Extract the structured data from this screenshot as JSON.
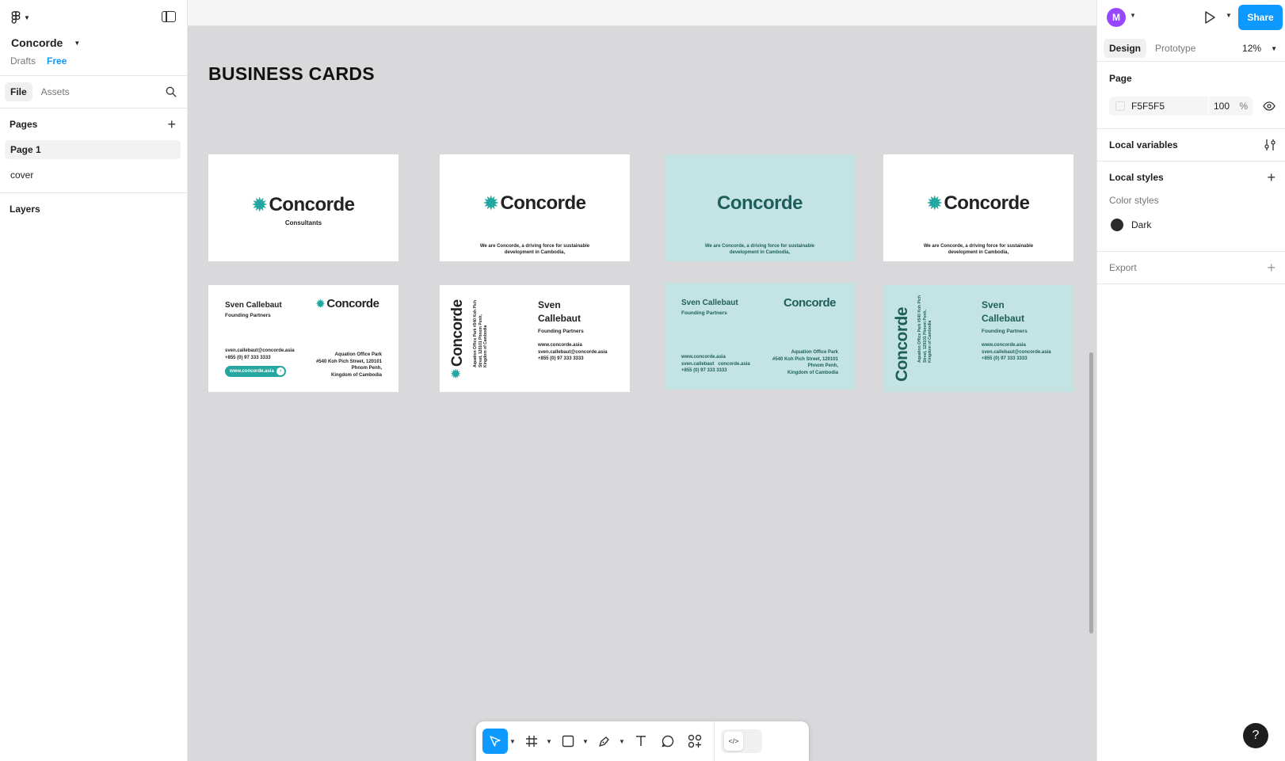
{
  "file": {
    "name": "Concorde",
    "location": "Drafts",
    "plan": "Free"
  },
  "left_tabs": [
    "File",
    "Assets"
  ],
  "pages": {
    "title": "Pages",
    "items": [
      "Page 1",
      "cover"
    ]
  },
  "layers": {
    "title": "Layers"
  },
  "canvas": {
    "title": "BUSINESS CARDS",
    "brand": "Concorde",
    "consultants": "Consultants",
    "tagline_1": "We are Concorde, a driving force for sustainable",
    "tagline_2": "development in Cambodia,",
    "person_name": "Sven Callebaut",
    "name_first": "Sven",
    "name_last": "Callebaut",
    "role": "Founding Partners",
    "email": "sven.callebaut@concorde.asia",
    "phone": "+855 (0) 97 333 3333",
    "website": "www.concorde.asia",
    "email_split_1": "sven.callebaut",
    "email_split_2": "concorde.asia",
    "addr_1": "Aquation Office Park",
    "addr_2": "#540 Koh Pich Street, 120101",
    "addr_3": "Phnom Penh,",
    "addr_4": "Kingdom of Cambodia",
    "vert_addr_1": "Aquation Office Park #540 Koh Pich",
    "vert_addr_2": "Street, 120101 Phnom Penh,",
    "vert_addr_3": "Kingdom of Cambodia"
  },
  "toolbar": {
    "tools": [
      "move-tool",
      "frame-tool",
      "shape-tool",
      "pen-tool",
      "text-tool",
      "comment-tool",
      "actions-tool"
    ],
    "dev_mode_icon": "</>"
  },
  "right_panel": {
    "avatar_initial": "M",
    "share_label": "Share",
    "tabs": [
      "Design",
      "Prototype"
    ],
    "zoom": "12%",
    "page_section": {
      "title": "Page",
      "fill_hex": "F5F5F5",
      "opacity": "100",
      "opacity_unit": "%"
    },
    "local_variables": "Local variables",
    "local_styles": "Local styles",
    "color_styles_label": "Color styles",
    "styles": [
      {
        "name": "Dark",
        "color": "#2c2c2c"
      }
    ],
    "export": "Export",
    "help": "?"
  },
  "colors": {
    "accent": "#0d99ff",
    "canvas_bg": "#d9d8da",
    "brand_teal": "#25a6a0",
    "card_teal": "#c3e4e3",
    "avatar": "#9747ff"
  }
}
